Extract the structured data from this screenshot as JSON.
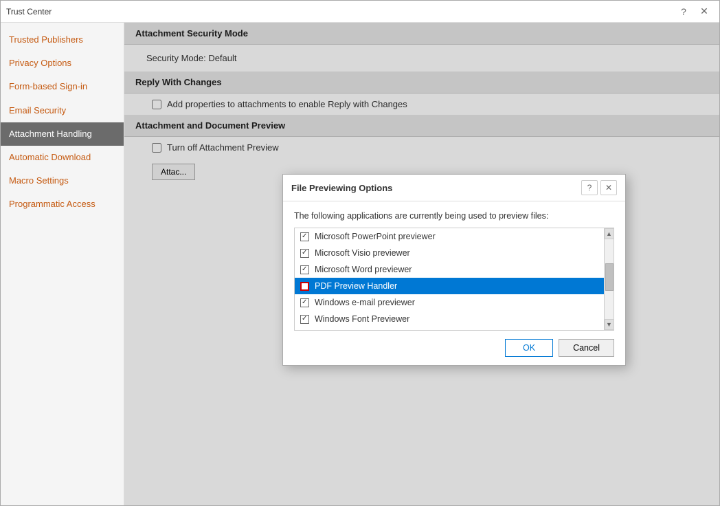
{
  "window": {
    "title": "Trust Center",
    "help_btn": "?",
    "close_btn": "✕"
  },
  "sidebar": {
    "items": [
      {
        "id": "trusted-publishers",
        "label": "Trusted Publishers",
        "active": false
      },
      {
        "id": "privacy-options",
        "label": "Privacy Options",
        "active": false
      },
      {
        "id": "form-based-signin",
        "label": "Form-based Sign-in",
        "active": false
      },
      {
        "id": "email-security",
        "label": "Email Security",
        "active": false
      },
      {
        "id": "attachment-handling",
        "label": "Attachment Handling",
        "active": true
      },
      {
        "id": "automatic-download",
        "label": "Automatic Download",
        "active": false
      },
      {
        "id": "macro-settings",
        "label": "Macro Settings",
        "active": false
      },
      {
        "id": "programmatic-access",
        "label": "Programmatic Access",
        "active": false
      }
    ]
  },
  "main": {
    "sections": [
      {
        "id": "attachment-security-mode",
        "header": "Attachment Security Mode",
        "content": "Security Mode: Default",
        "type": "text"
      },
      {
        "id": "reply-with-changes",
        "header": "Reply With Changes",
        "checkbox_label": "Add properties to attachments to enable Reply with Changes",
        "checkbox_checked": false,
        "type": "checkbox"
      },
      {
        "id": "attachment-document-preview",
        "header": "Attachment and Document Preview",
        "checkbox_label": "Turn off Attachment Preview",
        "checkbox_checked": false,
        "type": "checkbox_with_button",
        "button_label": "Attac..."
      }
    ]
  },
  "dialog": {
    "title": "File Previewing Options",
    "help_btn": "?",
    "close_btn": "✕",
    "description": "The following applications are currently being used to preview files:",
    "items": [
      {
        "id": "powerpoint",
        "label": "Microsoft PowerPoint previewer",
        "checked": true,
        "selected": false
      },
      {
        "id": "visio",
        "label": "Microsoft Visio previewer",
        "checked": true,
        "selected": false
      },
      {
        "id": "word",
        "label": "Microsoft Word previewer",
        "checked": true,
        "selected": false
      },
      {
        "id": "pdf",
        "label": "PDF Preview Handler",
        "checked": true,
        "selected": true
      },
      {
        "id": "email",
        "label": "Windows e-mail previewer",
        "checked": true,
        "selected": false
      },
      {
        "id": "font",
        "label": "Windows Font Previewer",
        "checked": true,
        "selected": false
      }
    ],
    "ok_label": "OK",
    "cancel_label": "Cancel"
  }
}
